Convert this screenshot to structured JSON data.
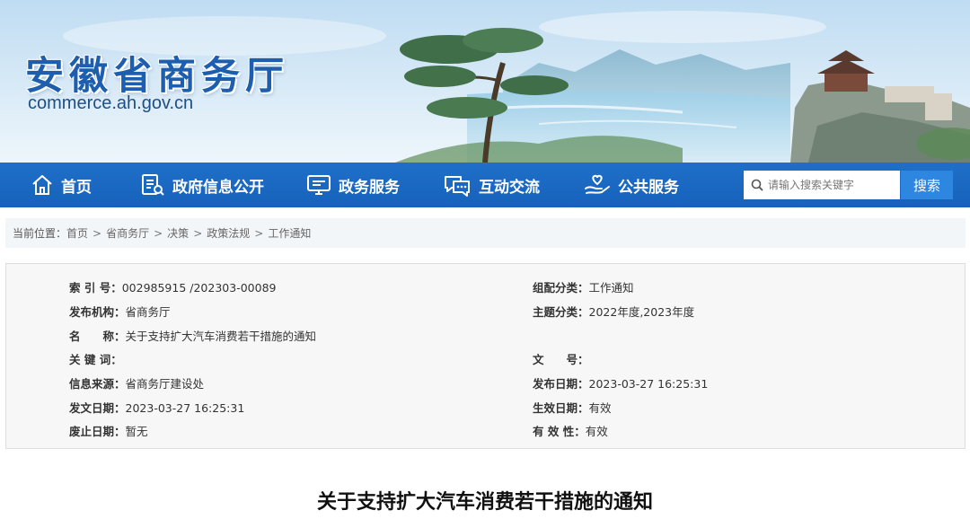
{
  "site": {
    "title": "安徽省商务厅",
    "domain": "commerce.ah.gov.cn"
  },
  "nav": {
    "items": [
      {
        "label": "首页",
        "icon": "home-icon"
      },
      {
        "label": "政府信息公开",
        "icon": "document-list-icon"
      },
      {
        "label": "政务服务",
        "icon": "monitor-icon"
      },
      {
        "label": "互动交流",
        "icon": "chat-icon"
      },
      {
        "label": "公共服务",
        "icon": "hands-heart-icon"
      }
    ],
    "search": {
      "placeholder": "请输入搜索关键字",
      "button": "搜索"
    }
  },
  "breadcrumb": {
    "prefix": "当前位置：",
    "items": [
      "首页",
      "省商务厅",
      "决策",
      "政策法规",
      "工作通知"
    ],
    "separator": ">"
  },
  "info": {
    "left": [
      {
        "label": "索 引 号：",
        "value": "002985915 /202303-00089"
      },
      {
        "label": "发布机构：",
        "value": "省商务厅"
      },
      {
        "label": "名　　称：",
        "value": "关于支持扩大汽车消费若干措施的通知"
      },
      {
        "label": "关 键 词：",
        "value": ""
      },
      {
        "label": "信息来源：",
        "value": "省商务厅建设处"
      },
      {
        "label": "发文日期：",
        "value": "2023-03-27 16:25:31"
      },
      {
        "label": "废止日期：",
        "value": "暂无"
      }
    ],
    "right": [
      {
        "label": "组配分类：",
        "value": "工作通知"
      },
      {
        "label": "主题分类：",
        "value": "2022年度,2023年度"
      },
      {
        "label": "",
        "value": ""
      },
      {
        "label": "文　　号：",
        "value": ""
      },
      {
        "label": "发布日期：",
        "value": "2023-03-27 16:25:31"
      },
      {
        "label": "生效日期：",
        "value": "有效"
      },
      {
        "label": "有 效 性：",
        "value": "有效"
      }
    ]
  },
  "article": {
    "title": "关于支持扩大汽车消费若干措施的通知"
  },
  "colors": {
    "nav_bg": "#1a66c0",
    "title_blue": "#1d5fae",
    "search_button": "#2d86e0"
  }
}
